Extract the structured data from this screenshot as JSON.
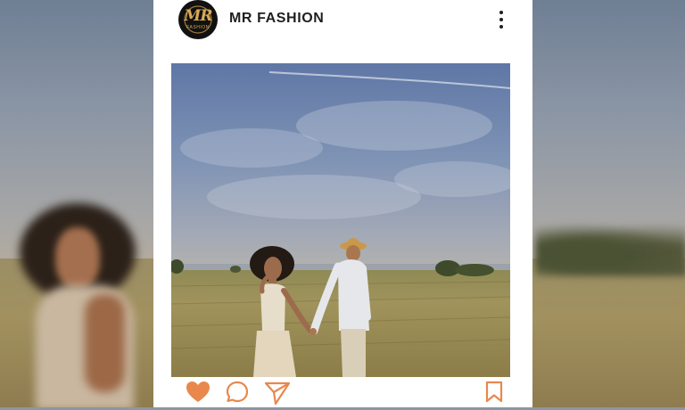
{
  "post": {
    "account_name": "MR FASHION",
    "avatar": {
      "logo_text": "MR",
      "logo_sub": "FASHION"
    },
    "photo_alt": "",
    "liked": true
  },
  "icons": {
    "more": "more-vertical-icon",
    "like": "heart-icon",
    "comment": "comment-icon",
    "share": "send-icon",
    "save": "bookmark-icon"
  },
  "colors": {
    "accent": "#e8884d",
    "card": "#ffffff",
    "text": "#1f1f1f"
  }
}
